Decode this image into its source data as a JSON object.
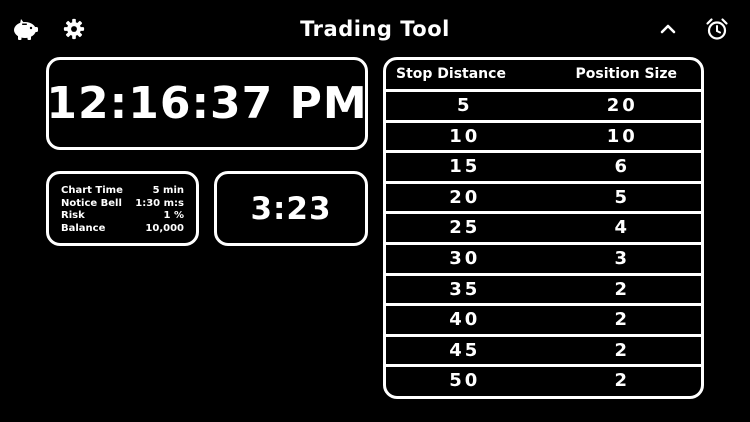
{
  "header": {
    "title": "Trading Tool",
    "icons": {
      "left_1": "piggy-bank-icon",
      "left_2": "gear-icon",
      "right_1": "chevron-up-icon",
      "right_2": "alarm-clock-icon"
    }
  },
  "clock": {
    "time": "12:16:37 PM"
  },
  "settings": {
    "rows": [
      {
        "label": "Chart Time",
        "value": "5 min"
      },
      {
        "label": "Notice Bell",
        "value": "1:30 m:s"
      },
      {
        "label": "Risk",
        "value": "1 %"
      },
      {
        "label": "Balance",
        "value": "10,000"
      }
    ]
  },
  "countdown": {
    "value": "3:23"
  },
  "table": {
    "headers": [
      "Stop Distance",
      "Position Size"
    ],
    "rows": [
      [
        "5",
        "20"
      ],
      [
        "10",
        "10"
      ],
      [
        "15",
        "6"
      ],
      [
        "20",
        "5"
      ],
      [
        "25",
        "4"
      ],
      [
        "30",
        "3"
      ],
      [
        "35",
        "2"
      ],
      [
        "40",
        "2"
      ],
      [
        "45",
        "2"
      ],
      [
        "50",
        "2"
      ]
    ]
  },
  "colors": {
    "background": "#000000",
    "foreground": "#ffffff"
  }
}
